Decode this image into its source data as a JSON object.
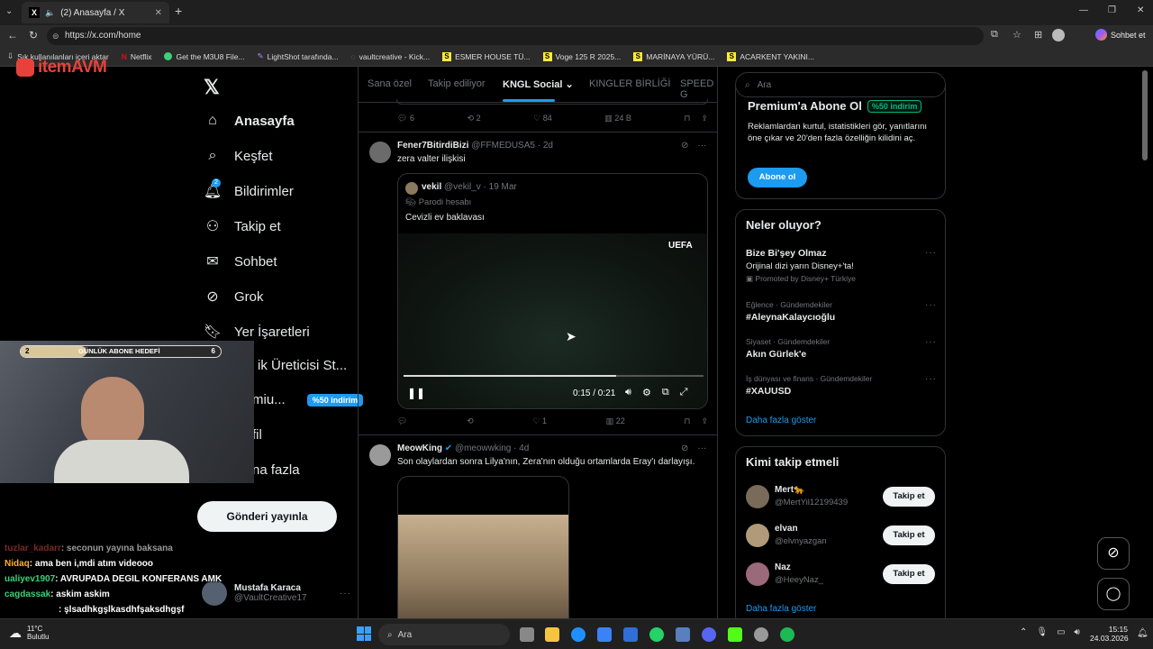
{
  "browser": {
    "tab_title": "(2) Anasayfa / X",
    "url": "https://x.com/home",
    "chat_label": "Sohbet et",
    "bookmarks": [
      {
        "label": "Sık kullanılanları içeri aktar"
      },
      {
        "label": "Netflix"
      },
      {
        "label": "Get the M3U8 File..."
      },
      {
        "label": "LightShot tarafında..."
      },
      {
        "label": "vaultcreative - Kick..."
      },
      {
        "label": "ESMER HOUSE TÜ..."
      },
      {
        "label": "Voge 125 R 2025..."
      },
      {
        "label": "MARİNAYA YÜRÜ..."
      },
      {
        "label": "ACARKENT YAKINI..."
      }
    ]
  },
  "overlay": {
    "logo": "itemAVM",
    "goal_label": "GÜNLÜK ABONE HEDEFİ",
    "goal_current": "2",
    "goal_target": "6",
    "goal_progress": 0.33
  },
  "sidebar": {
    "items": [
      {
        "label": "Anasayfa",
        "icon": "home-icon"
      },
      {
        "label": "Keşfet",
        "icon": "search-icon"
      },
      {
        "label": "Bildirimler",
        "icon": "bell-icon",
        "badge": "2"
      },
      {
        "label": "Takip et",
        "icon": "person-add-icon"
      },
      {
        "label": "Sohbet",
        "icon": "mail-icon"
      },
      {
        "label": "Grok",
        "icon": "grok-icon"
      },
      {
        "label": "Yer İşaretleri",
        "icon": "bookmark-icon"
      },
      {
        "label": "ik Üreticisi St..."
      },
      {
        "label": "miu...",
        "badge": "%50 indirim"
      },
      {
        "label": "fil"
      },
      {
        "label": "na fazla"
      }
    ],
    "post_button": "Gönderi yayınla",
    "account": {
      "name": "Mustafa Karaca",
      "handle": "@VaultCreative17"
    }
  },
  "feed": {
    "tabs": [
      "Sana özel",
      "Takip ediliyor",
      "KNGL Social",
      "KINGLER BİRLİĞİ",
      "SPEED G"
    ],
    "prev_actions": {
      "replies": "6",
      "retweets": "2",
      "likes": "84",
      "views": "24 B"
    },
    "tweet1": {
      "name": "Fener7BitirdiBizi",
      "handle": "@FFMEDUSA5 · 2d",
      "text": "zera valter ilişkisi",
      "quote": {
        "name": "vekil",
        "handle": "@vekil_v · 19 Mar",
        "parody": "Parodi hesabı",
        "text": "Cevizli ev baklavası"
      },
      "video": {
        "logo": "UEFA",
        "time": "0:15 / 0:21",
        "progress": 0.71
      },
      "actions": {
        "replies": "",
        "retweets": "",
        "likes": "1",
        "views": "22"
      }
    },
    "tweet2": {
      "name": "MeowKing",
      "handle": "@meowwking · 4d",
      "text": "Son olaylardan sonra Lilya'nın, Zera'nın olduğu ortamlarda Eray'ı darlayışı."
    }
  },
  "right": {
    "search_placeholder": "Ara",
    "premium": {
      "title": "Premium'a Abone Ol",
      "badge": "%50 indirim",
      "body": "Reklamlardan kurtul, istatistikleri gör, yanıtlarını öne çıkar ve 20'den fazla özelliğin kilidini aç.",
      "button": "Abone ol"
    },
    "trends": {
      "title": "Neler oluyor?",
      "items": [
        {
          "meta": "",
          "title": "Bize Bi'şey Olmaz",
          "sub": "Orijinal dizi yarın Disney+'ta!",
          "promo": "Promoted by Disney+ Türkiye"
        },
        {
          "meta": "Eğlence · Gündemdekiler",
          "title": "#AleynaKalaycıoğlu"
        },
        {
          "meta": "Siyaset · Gündemdekiler",
          "title": "Akın Gürlek'e"
        },
        {
          "meta": "İş dünyası ve finans · Gündemdekiler",
          "title": "#XAUUSD"
        }
      ],
      "more": "Daha fazla göster"
    },
    "follow": {
      "title": "Kimi takip etmeli",
      "users": [
        {
          "name": "Mert🐆",
          "handle": "@MertYil12199439",
          "button": "Takip et"
        },
        {
          "name": "elvan",
          "handle": "@elvnyazgan",
          "button": "Takip et"
        },
        {
          "name": "Naz",
          "handle": "@HeeyNaz_",
          "button": "Takip et"
        }
      ],
      "more": "Daha fazla göster"
    }
  },
  "chat": [
    {
      "user": "tuzlar_kadarr",
      "msg": ": seconun yayına baksana",
      "color": "#7a2a2a"
    },
    {
      "user": "Nidaq",
      "msg": ": ama ben i,mdi atım videooo",
      "color": "#ffb020"
    },
    {
      "user": "ualiyev1907",
      "msg": ": AVRUPADA DEGIL KONFERANS AMK",
      "color": "#3ad17a"
    },
    {
      "user": "cagdassak",
      "msg": ": askim askim",
      "color": "#3ad17a"
    },
    {
      "user": "",
      "msg": ": şlsadhkgşlkasdhfşaksdhgşf",
      "color": "#c03030"
    }
  ],
  "taskbar": {
    "weather_temp": "11°C",
    "weather_desc": "Bulutlu",
    "search": "Ara",
    "time": "15:15",
    "date": "24.03.2026"
  }
}
